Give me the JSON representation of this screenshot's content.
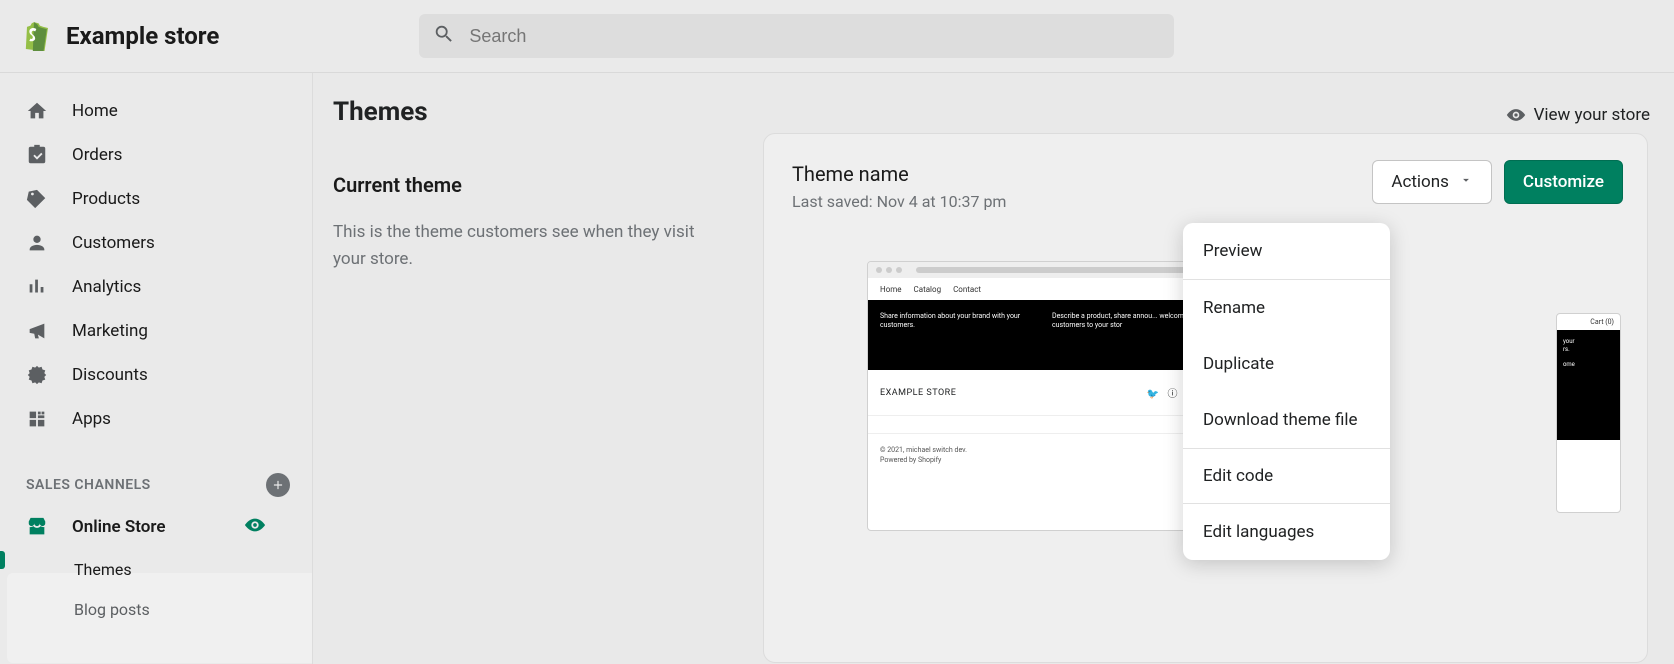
{
  "store_name": "Example store",
  "search": {
    "placeholder": "Search"
  },
  "sidebar": {
    "items": [
      {
        "label": "Home"
      },
      {
        "label": "Orders"
      },
      {
        "label": "Products"
      },
      {
        "label": "Customers"
      },
      {
        "label": "Analytics"
      },
      {
        "label": "Marketing"
      },
      {
        "label": "Discounts"
      },
      {
        "label": "Apps"
      }
    ],
    "section_label": "SALES CHANNELS",
    "channel": {
      "label": "Online Store"
    },
    "subnav": [
      {
        "label": "Themes"
      },
      {
        "label": "Blog posts"
      }
    ]
  },
  "page_title": "Themes",
  "view_store_label": "View your store",
  "current_theme": {
    "title": "Current theme",
    "description": "This is the theme customers see when they visit your store."
  },
  "theme": {
    "name": "Theme name",
    "saved": "Last saved: Nov 4 at 10:37 pm"
  },
  "buttons": {
    "actions": "Actions",
    "customize": "Customize"
  },
  "dropdown": {
    "preview": "Preview",
    "rename": "Rename",
    "duplicate": "Duplicate",
    "download": "Download theme file",
    "edit_code": "Edit code",
    "edit_languages": "Edit languages"
  },
  "preview": {
    "nav": {
      "home": "Home",
      "catalog": "Catalog",
      "contact": "Contact"
    },
    "banner_left": "Share information about your brand with your customers.",
    "banner_right": "Describe a product, share annou... welcome customers to your stor",
    "store": "EXAMPLE STORE",
    "copyright": "© 2021, michael switch dev.",
    "powered": "Powered by Shopify",
    "cart": "Cart (0)",
    "sec_line1": "your",
    "sec_line2": "rs.",
    "sec_line3": "ome"
  }
}
